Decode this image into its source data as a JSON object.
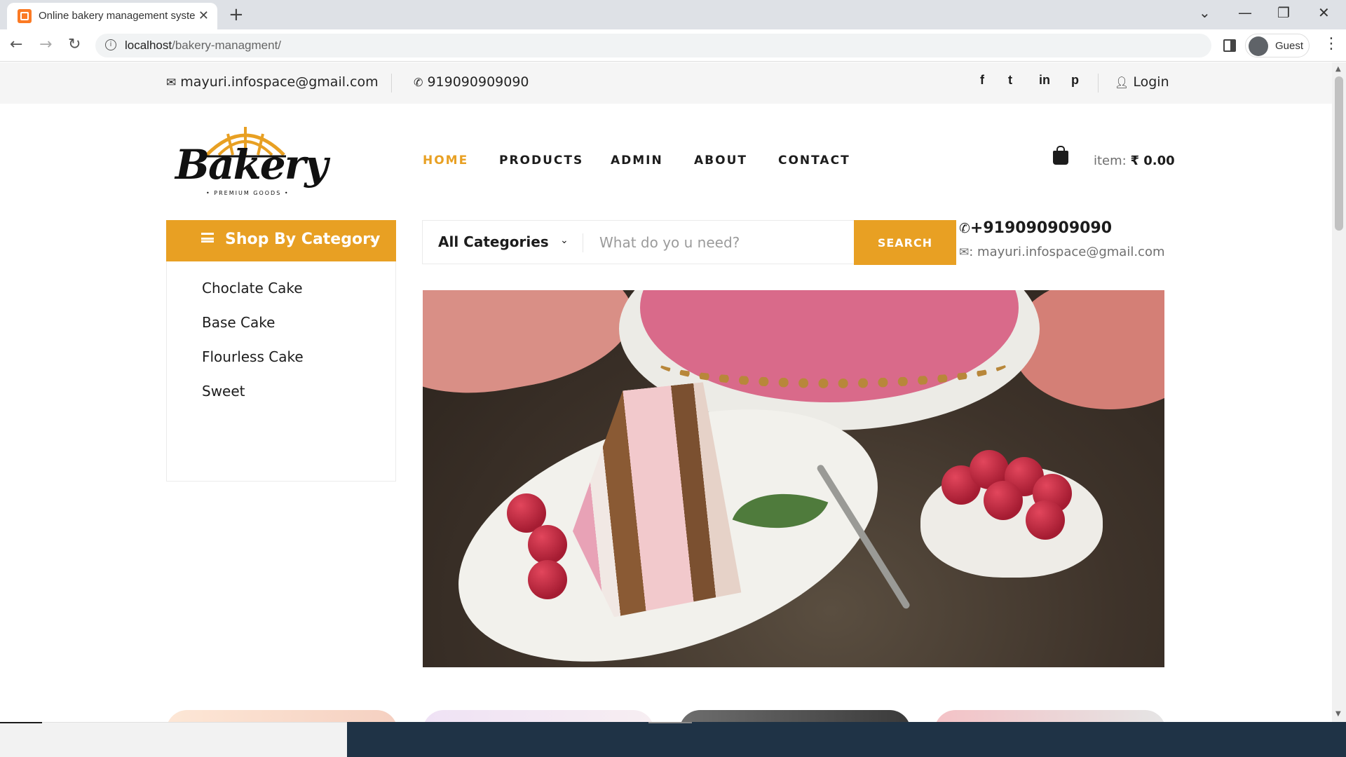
{
  "browser": {
    "tab_title": "Online bakery management syste",
    "tab_close": "✕",
    "new_tab": "+",
    "url_host": "localhost",
    "url_path": "/bakery-managment/",
    "guest_label": "Guest",
    "controls": {
      "dropdown": "⌄",
      "minimize": "—",
      "restore": "❐",
      "close": "✕"
    }
  },
  "topbar": {
    "email": "mayuri.infospace@gmail.com",
    "phone": "919090909090",
    "social": [
      "f",
      "t",
      "in",
      "p"
    ],
    "login_label": "Login"
  },
  "logo": {
    "word": "Bakery",
    "tagline": "• PREMIUM GOODS •",
    "accent_color": "#e8a023"
  },
  "nav": {
    "items": [
      "HOME",
      "PRODUCTS",
      "ADMIN",
      "ABOUT",
      "CONTACT"
    ],
    "active": "HOME"
  },
  "cart": {
    "label": "item:",
    "total": "₹ 0.00"
  },
  "sidebar": {
    "title": "Shop By Category",
    "items": [
      "Choclate Cake",
      "Base Cake",
      "Flourless Cake",
      "Sweet"
    ]
  },
  "search": {
    "category": "All Categories",
    "placeholder": "What do yo u need?",
    "button_label": "SEARCH"
  },
  "hero_contact": {
    "phone": "+919090909090",
    "email": ": mayuri.infospace@gmail.com"
  },
  "colors": {
    "accent": "#e8a023",
    "text": "#1c1c1c",
    "muted": "#6f6f6f",
    "footer": "#1f3346"
  },
  "icons": [
    "envelope-icon",
    "phone-icon",
    "facebook-icon",
    "twitter-icon",
    "linkedin-icon",
    "pinterest-icon",
    "user-icon",
    "shopping-bag-icon",
    "hamburger-icon",
    "chevron-down-icon"
  ]
}
